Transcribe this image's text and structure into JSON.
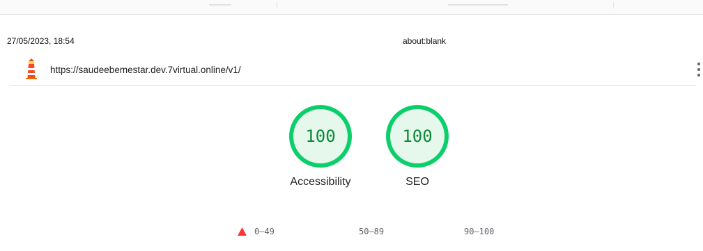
{
  "header": {
    "datetime": "27/05/2023, 18:54",
    "page_title": "about:blank"
  },
  "report": {
    "url": "https://saudeebemestar.dev.7virtual.online/v1/",
    "logo_icon": "lighthouse-icon",
    "menu_icon": "more-vertical-icon"
  },
  "gauges": [
    {
      "score": "100",
      "label": "Accessibility",
      "color": "#0cce6b"
    },
    {
      "score": "100",
      "label": "SEO",
      "color": "#0cce6b"
    }
  ],
  "legend": {
    "fail": {
      "range": "0–49",
      "color": "#ff3333",
      "icon": "triangle-icon"
    },
    "average": {
      "range": "50–89"
    },
    "pass": {
      "range": "90–100"
    }
  }
}
